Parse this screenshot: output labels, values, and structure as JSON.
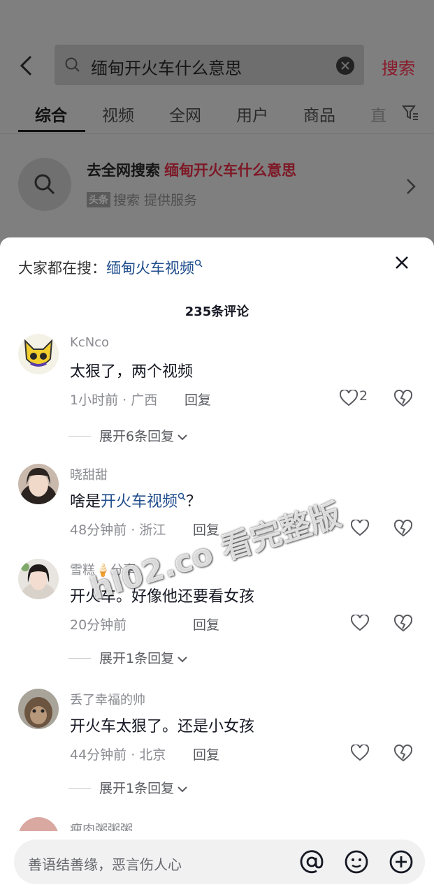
{
  "search": {
    "query": "缅甸开火车什么意思",
    "button": "搜索"
  },
  "tabs": [
    "综合",
    "视频",
    "全网",
    "用户",
    "商品",
    "直"
  ],
  "web_search": {
    "title": "去全网搜索",
    "keyword": "缅甸开火车什么意思",
    "badge": "头条",
    "provider": "搜索 提供服务"
  },
  "sheet": {
    "hot_prefix": "大家都在搜：",
    "hot_link": "缅甸火车视频",
    "comment_count": "235条评论"
  },
  "comments": [
    {
      "user": "KcNco",
      "text": "太狠了，两个视频",
      "meta": "1小时前 · 广西",
      "reply": "回复",
      "likes": "2",
      "expand": "展开6条回复"
    },
    {
      "user": "晓甜甜",
      "text_prefix": "啥是",
      "text_link": "开火车视频",
      "text_suffix": "？",
      "meta": "48分钟前 · 浙江",
      "reply": "回复"
    },
    {
      "user": "雪糕🍦分享",
      "text": "开火车。好像他还要看女孩",
      "meta": "20分钟前",
      "reply": "回复",
      "expand": "展开1条回复"
    },
    {
      "user": "丢了幸福的帅",
      "text": "开火车太狠了。还是小女孩",
      "meta": "44分钟前 · 北京",
      "reply": "回复",
      "expand": "展开1条回复"
    },
    {
      "user": "瘦肉粥粥粥"
    }
  ],
  "watermark": "hl02.co 看完整版",
  "input": {
    "placeholder": "善语结善缘，恶言伤人心"
  }
}
